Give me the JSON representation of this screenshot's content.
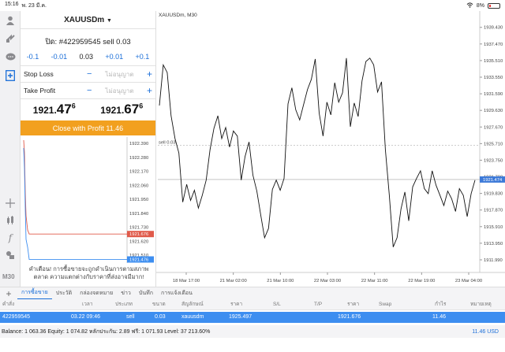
{
  "status": {
    "time": "15:16",
    "date": "พ. 23 มี.ค.",
    "battery": "8%"
  },
  "order": {
    "symbol": "XAUUSDm",
    "close_label": "ปิด: #422959545 sell 0.03",
    "lot_steps": [
      "-0.1",
      "-0.01",
      "0.03",
      "+0.01",
      "+0.1"
    ],
    "stop_loss_label": "Stop Loss",
    "take_profit_label": "Take Profit",
    "not_set": "ไม่อนุญาต",
    "bid": {
      "main": "1921.",
      "big": "47",
      "sup": "6"
    },
    "ask": {
      "main": "1921.",
      "big": "67",
      "sup": "6"
    },
    "close_button": "Close with Profit 11.46",
    "warning": "คำเตือน! การซื้อขายจะถูกดำเนินการตามสภาพตลาด ความแตกต่างกับราคาที่ส่งอาจมีมาก!"
  },
  "tick_chart": {
    "y_labels": [
      "1922.390",
      "1922.280",
      "1922.170",
      "1922.060",
      "1921.950",
      "1921.840",
      "1921.730",
      "1921.620",
      "1921.510"
    ],
    "ask_label": "1921.676",
    "bid_label": "1921.476",
    "colors": {
      "ask": "#e05a4a",
      "bid": "#3d8ef0"
    }
  },
  "chart_data": {
    "type": "line",
    "title": "XAUUSDm, M30",
    "x_labels": [
      "18 Mar 17:00",
      "21 Mar 02:00",
      "21 Mar 10:00",
      "22 Mar 03:00",
      "22 Mar 11:00",
      "22 Mar 19:00",
      "23 Mar 04:00"
    ],
    "y_labels": [
      "1939.430",
      "1937.470",
      "1935.510",
      "1933.550",
      "1931.590",
      "1929.630",
      "1927.670",
      "1925.710",
      "1923.750",
      "1921.790",
      "1919.830",
      "1917.870",
      "1915.910",
      "1913.950",
      "1911.990"
    ],
    "ylim": [
      1910.5,
      1940.8
    ],
    "sell_line": {
      "label": "sell 0.03",
      "value": 1925.497
    },
    "current_price": {
      "label": "1921.474",
      "value": 1921.474
    },
    "values": [
      1930.2,
      1935.0,
      1934.1,
      1929.0,
      1926.3,
      1924.6,
      1918.8,
      1920.9,
      1919.0,
      1920.2,
      1918.1,
      1919.6,
      1921.4,
      1925.0,
      1927.5,
      1929.0,
      1926.3,
      1927.6,
      1925.3,
      1927.2,
      1926.6,
      1921.4,
      1924.2,
      1925.9,
      1922.0,
      1920.1,
      1917.3,
      1914.6,
      1915.7,
      1920.3,
      1921.4,
      1920.2,
      1921.6,
      1930.4,
      1932.3,
      1929.7,
      1928.5,
      1930.3,
      1932.1,
      1933.3,
      1935.7,
      1929.3,
      1926.6,
      1930.6,
      1929.1,
      1932.9,
      1930.6,
      1931.7,
      1935.8,
      1927.7,
      1930.5,
      1928.9,
      1933.1,
      1935.4,
      1935.8,
      1935.0,
      1931.8,
      1933.0,
      1925.0,
      1919.6,
      1913.5,
      1914.6,
      1918.0,
      1920.0,
      1916.6,
      1920.6,
      1921.6,
      1922.5,
      1920.4,
      1919.8,
      1922.5,
      1920.8,
      1919.6,
      1918.4,
      1920.1,
      1919.2,
      1917.7,
      1920.4,
      1919.6,
      1917.1,
      1919.8,
      1921.4
    ],
    "colors": {
      "line": "#111111",
      "current": "#3d7ad8",
      "sell": "#bbbbbb"
    }
  },
  "tabs": {
    "items": [
      "การซื้อขาย",
      "ประวัติ",
      "กล่องจดหมาย",
      "ข่าว",
      "บันทึก",
      "การแจ้งเตือน"
    ]
  },
  "table": {
    "headers": [
      "คำสั่ง",
      "เวลา",
      "ประเภท",
      "ขนาด",
      "สัญลักษณ์",
      "ราคา",
      "S/L",
      "T/P",
      "ราคา",
      "Swap",
      "กำไร",
      "หมายเหตุ"
    ],
    "row": [
      "422959545",
      "03.22 09:46",
      "sell",
      "0.03",
      "xauusdm",
      "1925.497",
      "",
      "",
      "1921.676",
      "",
      "11.46",
      ""
    ]
  },
  "balance": {
    "text": "Balance: 1 063.36 Equity: 1 074.82 หลักประกัน: 2.89 ฟรี: 1 071.93 Level: 37 213.60%",
    "total": "11.46  USD"
  }
}
